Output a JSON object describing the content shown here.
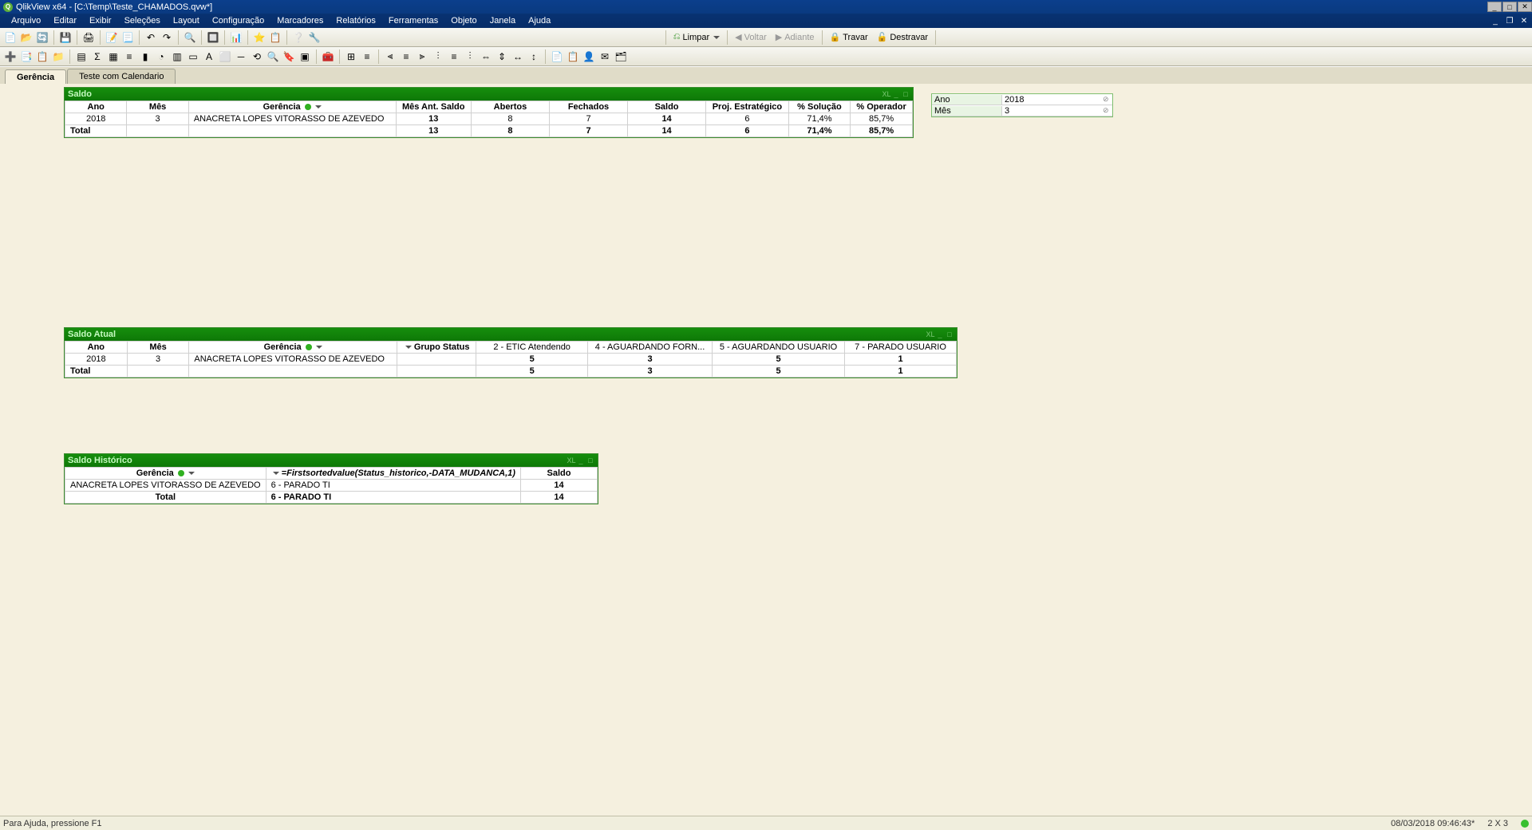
{
  "titlebar": {
    "app": "QlikView x64",
    "doc": "[C:\\Temp\\Teste_CHAMADOS.qvw*]"
  },
  "menu": {
    "arquivo": "Arquivo",
    "editar": "Editar",
    "exibir": "Exibir",
    "selecoes": "Seleções",
    "layout": "Layout",
    "config": "Configuração",
    "marcadores": "Marcadores",
    "relatorios": "Relatórios",
    "ferramentas": "Ferramentas",
    "objeto": "Objeto",
    "janela": "Janela",
    "ajuda": "Ajuda"
  },
  "nav": {
    "limpar": "Limpar",
    "voltar": "Voltar",
    "adiante": "Adiante",
    "travar": "Travar",
    "destravar": "Destravar"
  },
  "tabs": {
    "t1": "Gerência",
    "t2": "Teste com Calendario"
  },
  "chart1": {
    "title": "Saldo",
    "headers": {
      "ano": "Ano",
      "mes": "Mês",
      "ger": "Gerência",
      "mas": "Mês Ant. Saldo",
      "ab": "Abertos",
      "fc": "Fechados",
      "sd": "Saldo",
      "pe": "Proj. Estratégico",
      "sol": "% Solução",
      "op": "% Operador"
    },
    "row": {
      "ano": "2018",
      "mes": "3",
      "ger": "ANACRETA LOPES VITORASSO DE AZEVEDO",
      "mas": "13",
      "ab": "8",
      "fc": "7",
      "sd": "14",
      "pe": "6",
      "sol": "71,4%",
      "op": "85,7%"
    },
    "total": {
      "label": "Total",
      "mas": "13",
      "ab": "8",
      "fc": "7",
      "sd": "14",
      "pe": "6",
      "sol": "71,4%",
      "op": "85,7%"
    }
  },
  "chart2": {
    "title": "Saldo Atual",
    "headers": {
      "ano": "Ano",
      "mes": "Mês",
      "ger": "Gerência",
      "gs": "Grupo Status",
      "c2": "2 - ETIC Atendendo",
      "c4": "4 - AGUARDANDO FORN...",
      "c5": "5 - AGUARDANDO USUARIO",
      "c7": "7 - PARADO USUARIO"
    },
    "row": {
      "ano": "2018",
      "mes": "3",
      "ger": "ANACRETA LOPES VITORASSO DE AZEVEDO",
      "c2": "5",
      "c4": "3",
      "c5": "5",
      "c7": "1"
    },
    "total": {
      "label": "Total",
      "c2": "5",
      "c4": "3",
      "c5": "5",
      "c7": "1"
    }
  },
  "chart3": {
    "title": "Saldo Histórico",
    "headers": {
      "ger": "Gerência",
      "expr": "=Firstsortedvalue(Status_historico,-DATA_MUDANCA,1)",
      "sd": "Saldo"
    },
    "row": {
      "ger": "ANACRETA LOPES VITORASSO DE AZEVEDO",
      "expr": "6 - PARADO TI",
      "sd": "14"
    },
    "total": {
      "label": "Total",
      "expr": "6 - PARADO TI",
      "sd": "14"
    }
  },
  "selbox": {
    "ano_f": "Ano",
    "ano_v": "2018",
    "mes_f": "Mês",
    "mes_v": "3"
  },
  "status": {
    "help": "Para Ajuda, pressione F1",
    "datetime": "08/03/2018 09:46:43*",
    "sel": "2 X 3"
  },
  "chart_data": [
    {
      "type": "table",
      "title": "Saldo",
      "columns": [
        "Ano",
        "Mês",
        "Gerência",
        "Mês Ant. Saldo",
        "Abertos",
        "Fechados",
        "Saldo",
        "Proj. Estratégico",
        "% Solução",
        "% Operador"
      ],
      "rows": [
        [
          "2018",
          "3",
          "ANACRETA LOPES VITORASSO DE AZEVEDO",
          13,
          8,
          7,
          14,
          6,
          "71,4%",
          "85,7%"
        ]
      ],
      "totals": [
        "Total",
        "",
        "",
        13,
        8,
        7,
        14,
        6,
        "71,4%",
        "85,7%"
      ]
    },
    {
      "type": "table",
      "title": "Saldo Atual",
      "columns": [
        "Ano",
        "Mês",
        "Gerência",
        "2 - ETIC Atendendo",
        "4 - AGUARDANDO FORN...",
        "5 - AGUARDANDO USUARIO",
        "7 - PARADO USUARIO"
      ],
      "rows": [
        [
          "2018",
          "3",
          "ANACRETA LOPES VITORASSO DE AZEVEDO",
          5,
          3,
          5,
          1
        ]
      ],
      "totals": [
        "Total",
        "",
        "",
        5,
        3,
        5,
        1
      ]
    },
    {
      "type": "table",
      "title": "Saldo Histórico",
      "columns": [
        "Gerência",
        "=Firstsortedvalue(Status_historico,-DATA_MUDANCA,1)",
        "Saldo"
      ],
      "rows": [
        [
          "ANACRETA LOPES VITORASSO DE AZEVEDO",
          "6 - PARADO TI",
          14
        ]
      ],
      "totals": [
        "Total",
        "6 - PARADO TI",
        14
      ]
    }
  ]
}
